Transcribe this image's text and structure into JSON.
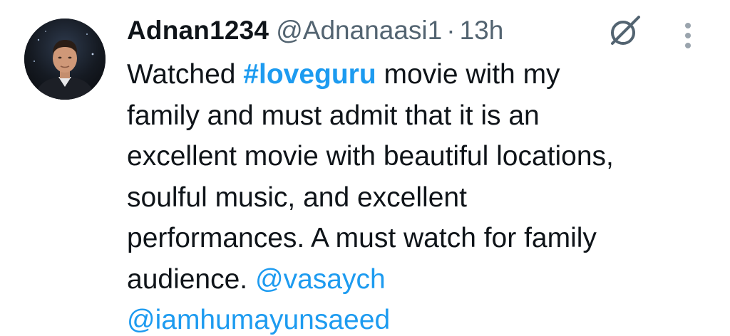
{
  "tweet": {
    "author": {
      "display_name": "Adnan1234",
      "handle": "@Adnanaasi1",
      "separator": "·",
      "time": "13h"
    },
    "lines": {
      "l1_prefix": "Watched ",
      "l1_hashtag": "#loveguru",
      "l1_suffix": " movie with my",
      "l2": "family and must admit that it is an",
      "l3": "excellent movie with beautiful locations,",
      "l4": "soulful music, and excellent",
      "l5": "performances. A must watch for family",
      "l6_prefix": "audience. ",
      "l6_mention": "@vasaych",
      "l7_mention": "@iamhumayunsaeed"
    },
    "icons": {
      "grok": "grok-icon",
      "more": "more-vertical-icon",
      "avatar": "avatar"
    },
    "colors": {
      "text": "#0f1419",
      "secondary": "#536471",
      "link": "#1d9bf0",
      "background": "#ffffff"
    }
  }
}
